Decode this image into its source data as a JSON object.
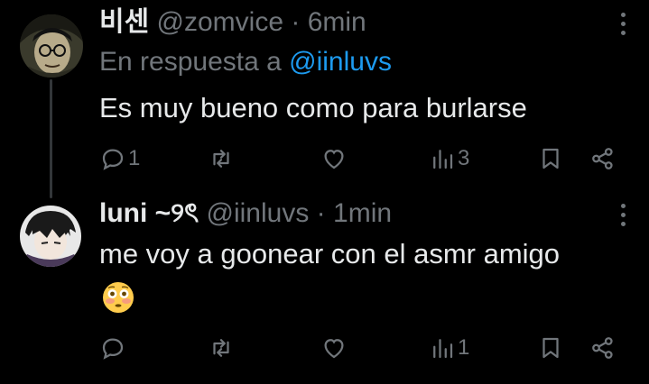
{
  "tweets": [
    {
      "display_name": "비센",
      "handle": "@zomvice",
      "separator": "·",
      "time": "6min",
      "reply_prefix": "En respuesta a",
      "reply_mention": "@iinluvs",
      "text": "Es muy bueno como para burlarse",
      "actions": {
        "reply_count": "1",
        "retweet_count": "",
        "like_count": "",
        "views_count": "3"
      }
    },
    {
      "display_name": "luni ~୨ৎ",
      "handle": "@iinluvs",
      "separator": "·",
      "time": "1min",
      "text": "me voy a goonear con el asmr amigo",
      "emoji": "flushed-face",
      "actions": {
        "reply_count": "",
        "retweet_count": "",
        "like_count": "",
        "views_count": "1"
      }
    }
  ],
  "colors": {
    "background": "#000000",
    "text": "#e7e9ea",
    "muted": "#71767b",
    "link": "#1d9bf0",
    "thread_line": "#333639"
  }
}
